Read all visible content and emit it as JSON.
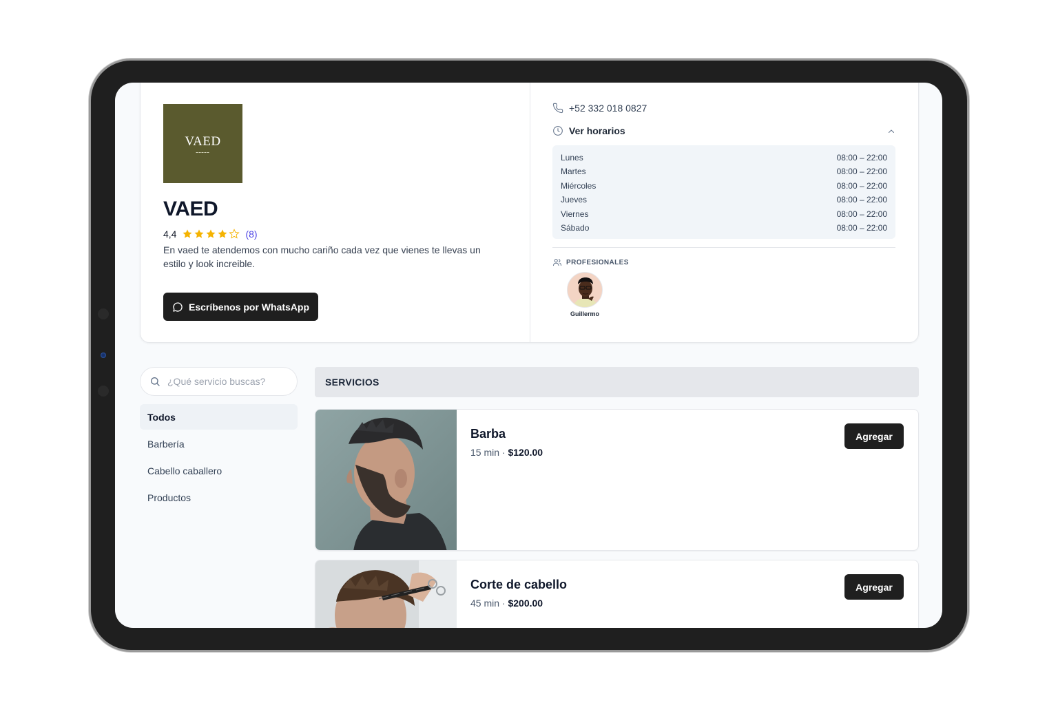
{
  "business": {
    "logo_text": "VAED",
    "name": "VAED",
    "rating": "4,4",
    "rating_stars": 4.4,
    "review_count": "(8)",
    "description": "En vaed te atendemos con mucho cariño cada vez que vienes te llevas un estilo y look increible.",
    "whatsapp_label": "Escríbenos por WhatsApp",
    "brand_color": "#5a5a2e"
  },
  "contact": {
    "phone": "+52 332 018 0827",
    "hours_label": "Ver horarios",
    "hours": [
      {
        "day": "Lunes",
        "time": "08:00 – 22:00"
      },
      {
        "day": "Martes",
        "time": "08:00 – 22:00"
      },
      {
        "day": "Miércoles",
        "time": "08:00 – 22:00"
      },
      {
        "day": "Jueves",
        "time": "08:00 – 22:00"
      },
      {
        "day": "Viernes",
        "time": "08:00 – 22:00"
      },
      {
        "day": "Sábado",
        "time": "08:00 – 22:00"
      }
    ]
  },
  "professionals": {
    "title": "PROFESIONALES",
    "items": [
      {
        "name": "Guillermo"
      }
    ]
  },
  "search": {
    "placeholder": "¿Qué servicio buscas?"
  },
  "categories": [
    {
      "label": "Todos",
      "active": true
    },
    {
      "label": "Barbería"
    },
    {
      "label": "Cabello caballero"
    },
    {
      "label": "Productos"
    }
  ],
  "services": {
    "header": "SERVICIOS",
    "items": [
      {
        "name": "Barba",
        "duration": "15 min",
        "separator": " · ",
        "price": "$120.00",
        "button": "Agregar"
      },
      {
        "name": "Corte de cabello",
        "duration": "45 min",
        "separator": " · ",
        "price": "$200.00",
        "button": "Agregar"
      }
    ]
  },
  "icons": {
    "phone": "phone-icon",
    "clock": "clock-icon",
    "chevron": "chevron-up-icon",
    "users": "users-icon",
    "search": "search-icon",
    "chat": "chat-bubble-icon",
    "star": "star-icon"
  },
  "colors": {
    "star": "#f5b301",
    "accent_link": "#4f46e5",
    "button_dark": "#1f1f1f"
  }
}
